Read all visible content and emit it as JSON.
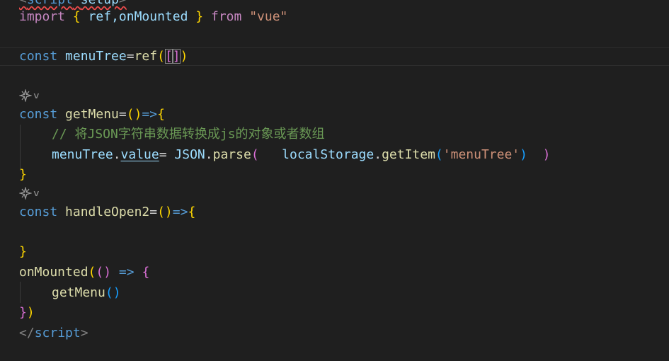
{
  "editor": {
    "line0": {
      "open": "<",
      "tag": "script",
      "attr": "setup",
      "close": ">"
    },
    "line1": {
      "kw": "import",
      "brace_open": "{",
      "names": "ref,onMounted",
      "brace_close": "}",
      "from": "from",
      "source": "\"vue\""
    },
    "line3": {
      "kw": "const",
      "name": "menuTree",
      "eq": "=",
      "fn": "ref",
      "paren_open": "(",
      "bracket_open": "[",
      "bracket_close": "]",
      "paren_close": ")"
    },
    "line6": {
      "kw": "const",
      "name": "getMenu",
      "eq": "=",
      "parens": "()",
      "arrow": "=>",
      "brace": "{"
    },
    "line7": {
      "comment": "// 将JSON字符串数据转换成js的对象或者数组"
    },
    "line8": {
      "obj": "menuTree",
      "dot1": ".",
      "prop": "value",
      "eq": "= ",
      "json": "JSON",
      "dot2": ".",
      "parse": "parse",
      "paren_open": "(",
      "spaces": "   ",
      "storage": "localStorage",
      "dot3": ".",
      "getitem": "getItem",
      "inner_open": "(",
      "key": "'menuTree'",
      "inner_close": ")",
      "gap": "  ",
      "paren_close": ")"
    },
    "line9": {
      "brace": "}"
    },
    "line11": {
      "kw": "const",
      "name": "handleOpen2",
      "eq": "=",
      "parens": "()",
      "arrow": "=>",
      "brace": "{"
    },
    "line13": {
      "brace": "}"
    },
    "line14": {
      "fn": "onMounted",
      "paren_open": "(",
      "parens": "()",
      "arrow": "=>",
      "brace": "{"
    },
    "line15": {
      "fn": "getMenu",
      "parens": "()"
    },
    "line16": {
      "brace": "}",
      "paren": ")"
    },
    "line17": {
      "open": "</",
      "tag": "script",
      "close": ">"
    }
  },
  "icons": {
    "codelens": "ai-sparkle-icon",
    "chevron": "chevron-down-icon"
  },
  "colors": {
    "background": "#1f1f1f",
    "keyword": "#569cd6",
    "control_keyword": "#c586c0",
    "variable": "#9cdcfe",
    "function": "#dcdcaa",
    "string": "#ce9178",
    "comment": "#6a9955",
    "bracket_level1": "#ffd700",
    "bracket_level2": "#da70d6",
    "bracket_level3": "#179fff"
  }
}
